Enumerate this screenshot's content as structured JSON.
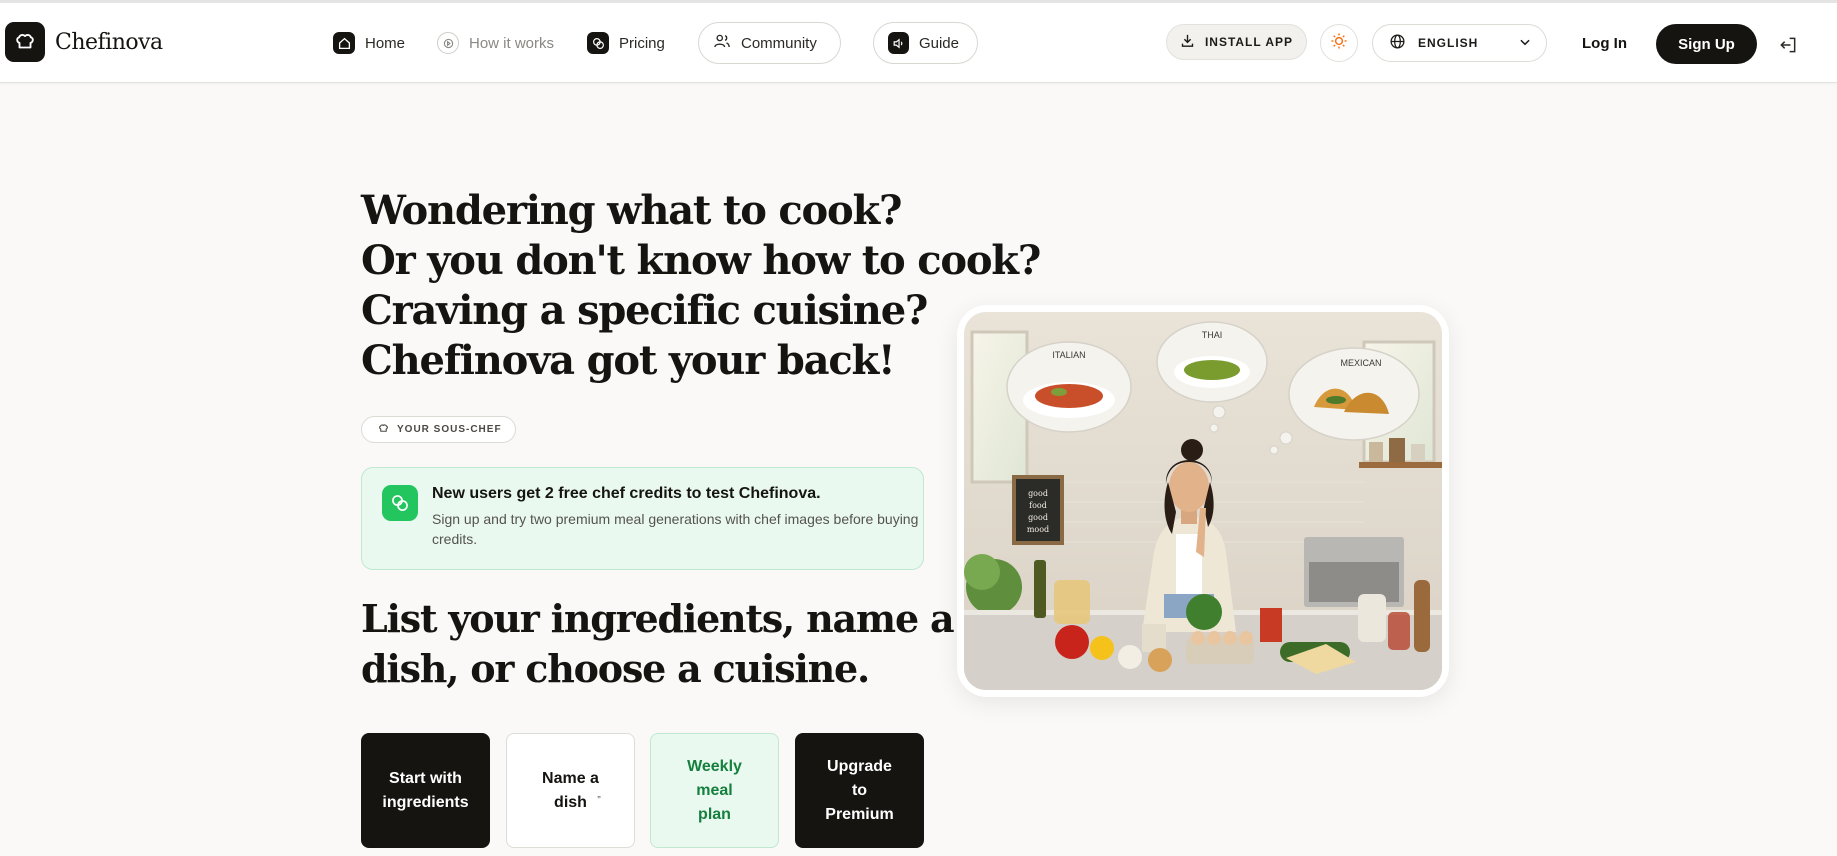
{
  "brand": {
    "name": "Chefinova"
  },
  "nav": {
    "home": "Home",
    "how_it_works": "How it works",
    "pricing": "Pricing",
    "community": "Community",
    "guide": "Guide"
  },
  "header": {
    "install_app": "INSTALL APP",
    "language": "ENGLISH",
    "login": "Log In",
    "signup": "Sign Up"
  },
  "hero": {
    "lines": [
      "Wondering what to cook?",
      "Or you don't know how to cook?",
      "Craving a specific cuisine?",
      "Chefinova got your back!"
    ],
    "badge": "YOUR SOUS-CHEF",
    "promo_title": "New users get 2 free chef credits to test Chefinova.",
    "promo_body": "Sign up and try two premium meal generations with chef images before buying credits.",
    "subtitle_lines": [
      "List your ingredients, name a",
      "dish, or choose a cuisine."
    ]
  },
  "actions": {
    "ingredients": "Start with ingredients",
    "dish": "Name a dish",
    "weekly": "Weekly meal plan",
    "premium": "Upgrade to Premium"
  },
  "illustration": {
    "bubbles": [
      "ITALIAN",
      "THAI",
      "MEXICAN"
    ],
    "chalkboard": [
      "good",
      "food",
      "good",
      "mood"
    ]
  },
  "colors": {
    "ink": "#151411",
    "background": "#faf9f7",
    "promo_green": "#22c55e",
    "promo_bg": "#eaf9f0",
    "weekly_text": "#15803d",
    "theme_icon": "#f97316"
  },
  "icons": {
    "brand": "chef-hat-icon",
    "home": "home-icon",
    "how_it_works": "play-circle-icon",
    "pricing": "coins-icon",
    "community": "users-icon",
    "guide": "speaker-icon",
    "install": "download-icon",
    "theme": "sun-icon",
    "language": "globe-icon",
    "exit": "logout-icon"
  }
}
